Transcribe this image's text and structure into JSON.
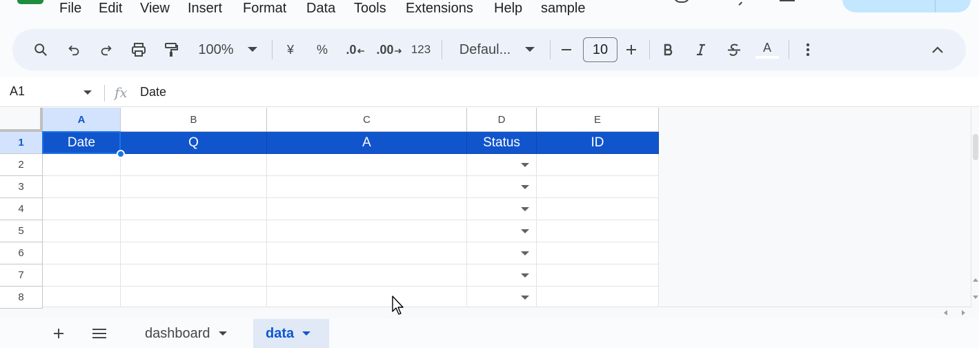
{
  "menu": {
    "items": [
      "File",
      "Edit",
      "View",
      "Insert",
      "Format",
      "Data",
      "Tools",
      "Extensions",
      "Help"
    ],
    "doc_title": "sample"
  },
  "toolbar": {
    "zoom": "100%",
    "currency": "¥",
    "percent": "%",
    "decrease_decimal": ".0",
    "increase_decimal": ".00",
    "number_format": "123",
    "font_family": "Defaul...",
    "font_size": "10",
    "text_color_label": "A"
  },
  "formula_bar": {
    "cell_ref": "A1",
    "fx": "fx",
    "content": "Date"
  },
  "grid": {
    "columns": [
      "A",
      "B",
      "C",
      "D",
      "E"
    ],
    "rows": [
      "1",
      "2",
      "3",
      "4",
      "5",
      "6",
      "7",
      "8"
    ],
    "header_values": [
      "Date",
      "Q",
      "A",
      "Status",
      "ID"
    ],
    "header_fill": "#1155cc",
    "selected_cell": "A1"
  },
  "sheets": {
    "tabs": [
      {
        "label": "dashboard",
        "active": false
      },
      {
        "label": "data",
        "active": true
      }
    ]
  },
  "colors": {
    "accent": "#0b57d0",
    "toolbar_bg": "#edf2fa",
    "selection": "#1a73e8"
  }
}
